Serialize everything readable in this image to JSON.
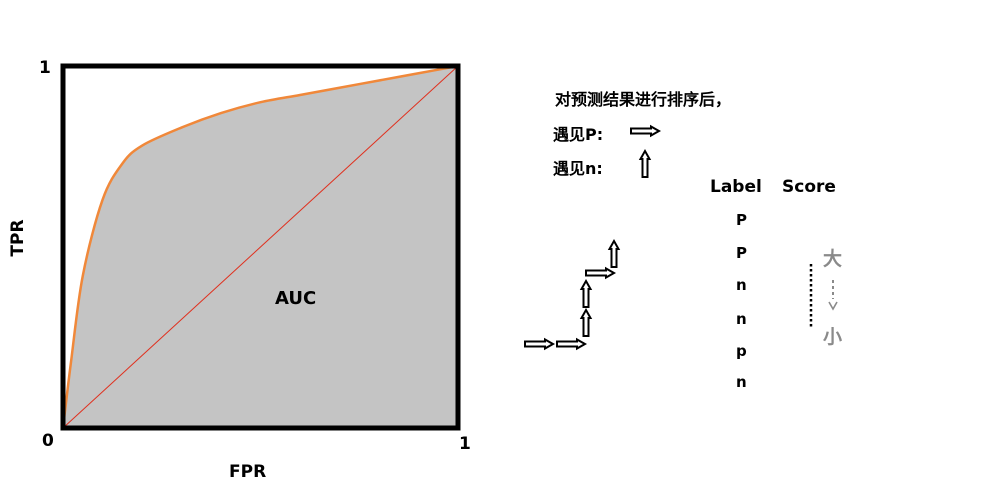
{
  "roc": {
    "axis_tick_y_top": "1",
    "axis_tick_origin": "0",
    "axis_tick_x_right": "1",
    "y_axis_label": "TPR",
    "x_axis_label": "FPR",
    "area_label": "AUC",
    "colors": {
      "curve": "#f0883a",
      "diagonal": "#e0301e",
      "area": "#c4c4c4",
      "frame": "#000000"
    }
  },
  "legend": {
    "intro": "对预测结果进行排序后，",
    "see_p": "遇见P:",
    "see_n": "遇见n:"
  },
  "table": {
    "headers": [
      "Label",
      "Score"
    ],
    "rows": [
      "P",
      "P",
      "n",
      "n",
      "p",
      "n"
    ]
  },
  "order": {
    "large": "大",
    "small": "小",
    "color": "#8a8a8a"
  },
  "chart_data": {
    "type": "line",
    "xlabel": "FPR",
    "ylabel": "TPR",
    "xlim": [
      0,
      1
    ],
    "ylim": [
      0,
      1
    ],
    "series": [
      {
        "x": [
          0,
          0.02,
          0.05,
          0.1,
          0.15,
          0.2,
          0.3,
          0.4,
          0.5,
          0.6,
          0.7,
          0.8,
          0.9,
          1
        ],
        "y": [
          0,
          0.18,
          0.42,
          0.63,
          0.73,
          0.78,
          0.83,
          0.87,
          0.9,
          0.92,
          0.94,
          0.96,
          0.98,
          1
        ]
      },
      {
        "x": [
          0,
          1
        ],
        "y": [
          0,
          1
        ]
      }
    ]
  }
}
